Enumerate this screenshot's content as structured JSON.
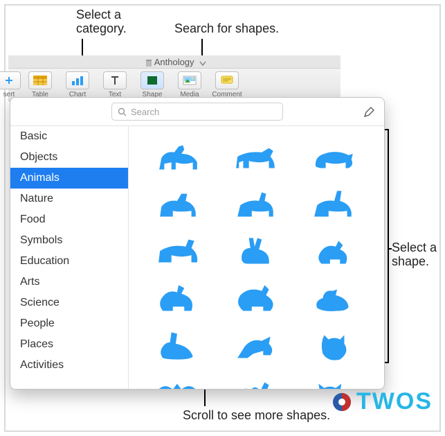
{
  "callouts": {
    "category": "Select a\ncategory.",
    "search": "Search for shapes.",
    "selectshape": "Select a\nshape.",
    "scroll": "Scroll to see more shapes."
  },
  "titlebar": {
    "docname": "Anthology"
  },
  "toolbar": {
    "insert": "sert",
    "table": "Table",
    "chart": "Chart",
    "text": "Text",
    "shape": "Shape",
    "media": "Media",
    "comment": "Comment"
  },
  "search": {
    "placeholder": "Search"
  },
  "categories": {
    "items": [
      "Basic",
      "Objects",
      "Animals",
      "Nature",
      "Food",
      "Symbols",
      "Education",
      "Arts",
      "Science",
      "People",
      "Places",
      "Activities"
    ],
    "selected_index": 2
  },
  "shapes": {
    "names": [
      "horse",
      "cow",
      "pig",
      "dog",
      "goat",
      "donkey",
      "ox",
      "rabbit",
      "hen",
      "rooster",
      "turkey",
      "duck",
      "goose",
      "bird",
      "owl",
      "bat",
      "camel",
      "cat"
    ]
  },
  "watermark": {
    "text": "TWOS"
  }
}
